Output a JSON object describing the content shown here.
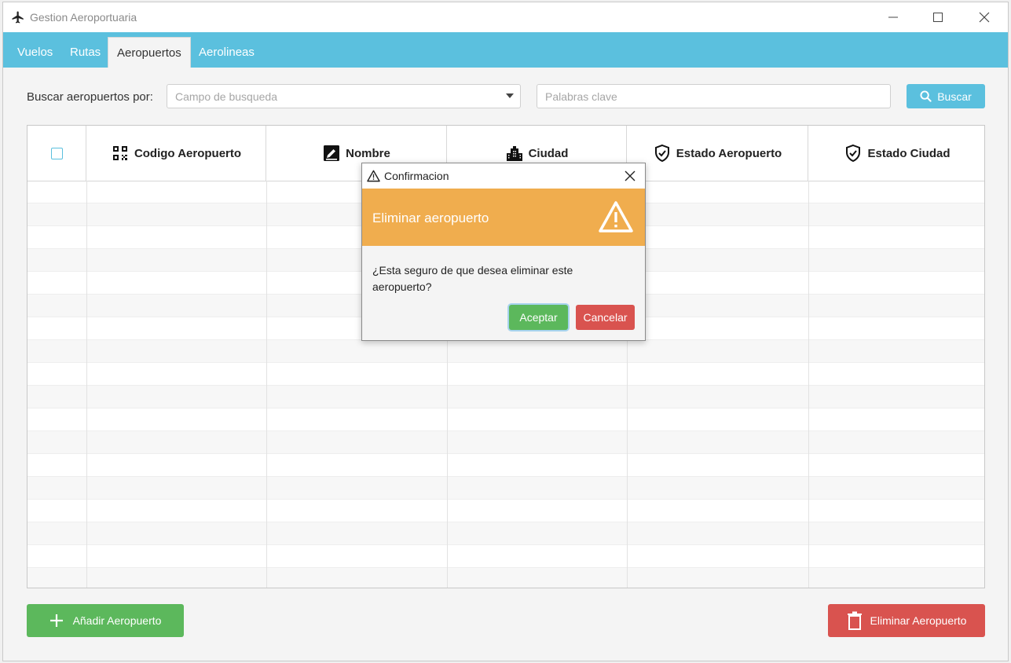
{
  "window": {
    "title": "Gestion Aeroportuaria",
    "icons": {
      "app": "airplane-icon",
      "minimize": "minimize-icon",
      "maximize": "maximize-icon",
      "close": "close-icon"
    }
  },
  "tabs": [
    {
      "label": "Vuelos",
      "active": false
    },
    {
      "label": "Rutas",
      "active": false
    },
    {
      "label": "Aeropuertos",
      "active": true
    },
    {
      "label": "Aerolineas",
      "active": false
    }
  ],
  "search": {
    "label": "Buscar aeropuertos por:",
    "field_placeholder": "Campo de busqueda",
    "keywords_placeholder": "Palabras clave",
    "button_label": "Buscar",
    "button_icon": "search-icon"
  },
  "table": {
    "columns": [
      {
        "label": "Codigo Aeropuerto",
        "icon": "qr-code-icon"
      },
      {
        "label": "Nombre",
        "icon": "edit-icon"
      },
      {
        "label": "Ciudad",
        "icon": "city-icon"
      },
      {
        "label": "Estado Aeropuerto",
        "icon": "shield-check-icon"
      },
      {
        "label": "Estado Ciudad",
        "icon": "shield-check-icon"
      }
    ],
    "rows": []
  },
  "actions": {
    "add_label": "Añadir Aeropuerto",
    "add_icon": "plus-icon",
    "delete_label": "Eliminar Aeropuerto",
    "delete_icon": "trash-icon"
  },
  "dialog": {
    "title": "Confirmacion",
    "title_icon": "warning-icon",
    "header": "Eliminar aeropuerto",
    "header_icon": "warning-icon",
    "message": "¿Esta seguro de que desea eliminar este aeropuerto?",
    "accept_label": "Aceptar",
    "cancel_label": "Cancelar"
  },
  "colors": {
    "tabbar": "#5bc0de",
    "dialog_header": "#f0ad4e",
    "success": "#5cb85c",
    "danger": "#d9534f"
  }
}
